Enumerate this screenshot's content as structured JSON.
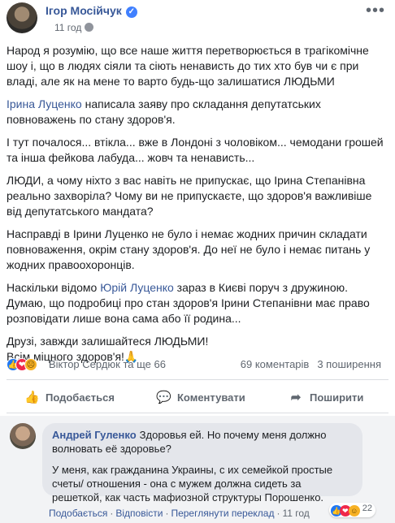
{
  "post": {
    "author": "Ігор Мосійчук",
    "time": "11 год",
    "paragraphs": [
      [
        {
          "text": "Народ я розумію, що все наше життя перетворюється в трагікомічне шоу і, що в людях сіяли та сіють ненависть до тих хто був чи є при владі, але як на мене то варто будь-що залишатися ЛЮДЬМИ"
        }
      ],
      [
        {
          "text": "Ірина Луценко",
          "link": true
        },
        {
          "text": " написала заяву про складання депутатських повноважень по стану здоров'я."
        }
      ],
      [
        {
          "text": "І тут почалося... втікла... вже в Лондоні з чоловіком... чемодани грошей та інша фейкова лабуда... жовч та ненависть..."
        }
      ],
      [
        {
          "text": "ЛЮДИ, а чому ніхто з вас навіть не припускає, що Ірина Степанівна реально захворіла? Чому ви не припускаєте, що здоров'я важливіше від депутатського мандата?"
        }
      ],
      [
        {
          "text": "Насправді в Ірини Луценко не було і немає жодних причин складати повноваження, окрім стану здоров'я. До неї не було і немає питань у жодних правоохоронців."
        }
      ],
      [
        {
          "text": "Наскільки відомо "
        },
        {
          "text": "Юрій Луценко",
          "link": true
        },
        {
          "text": " зараз в Києві поруч з дружиною. Думаю, що подробиці про стан здоров'я Ірини Степанівни має право розповідати лише вона сама або її родина..."
        }
      ],
      [
        {
          "text": "Друзі, завжди залишайтеся ЛЮДЬМИ!\nВсім міцного здоров'я!🙏"
        }
      ]
    ]
  },
  "reactions": {
    "names": "Віктор Сердюк та ще 66",
    "comments": "69 коментарів",
    "shares": "3 поширення"
  },
  "actions": {
    "like": "Подобається",
    "comment": "Коментувати",
    "share": "Поширити"
  },
  "comment": {
    "author": "Андрей Гуленко",
    "text1": "Здоровья ей. Но почему меня должно волновать её здоровье?",
    "text2": "У меня, как гражданина Украины, с их семейкой простые счеты/ отношения - она с мужем должна сидеть за решеткой, как часть мафиозной структуры Порошенко.",
    "like": "Подобається",
    "reply": "Відповісти",
    "translate": "Переглянути переклад",
    "time": "11 год",
    "reaction_count": "22"
  }
}
